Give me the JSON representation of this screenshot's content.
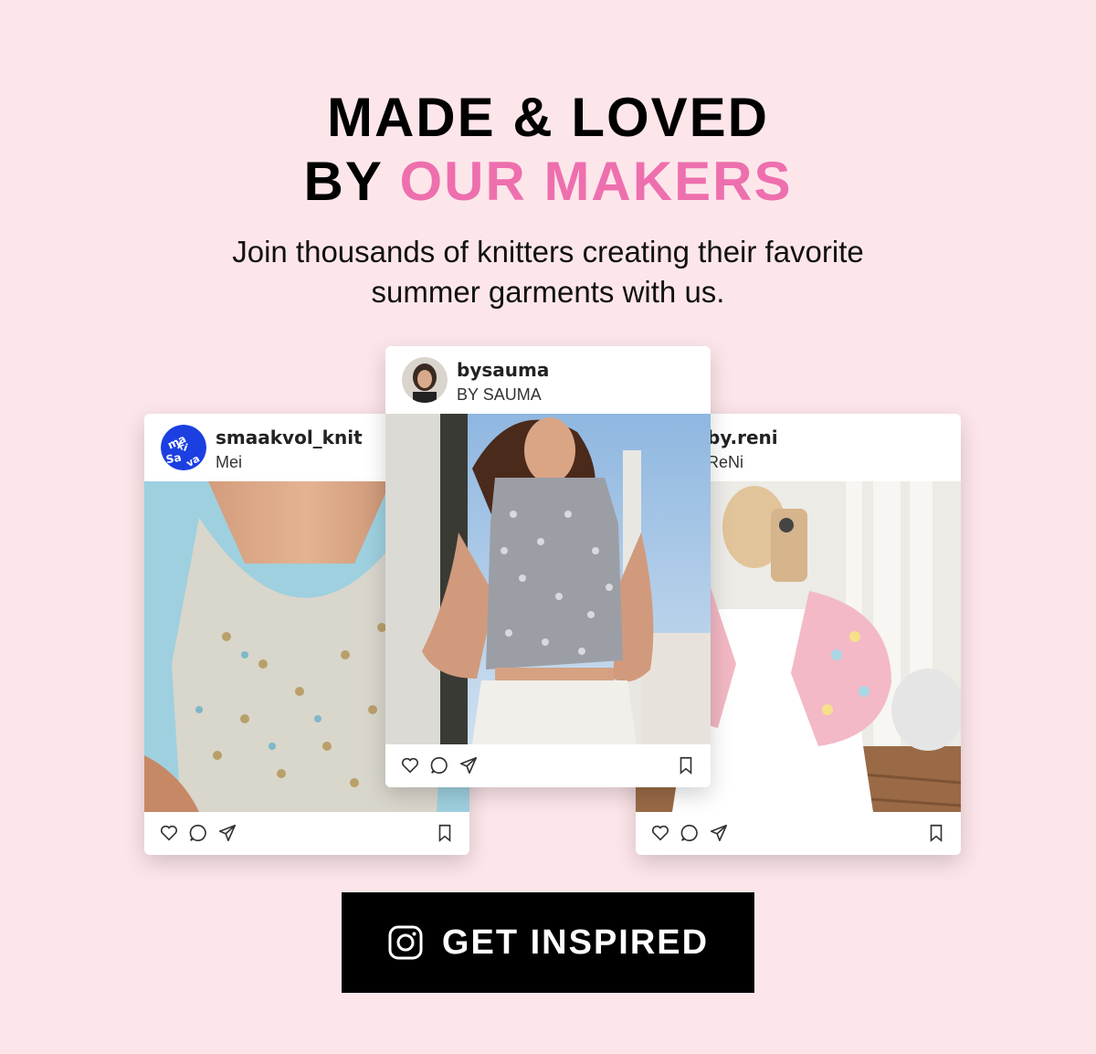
{
  "headline": {
    "line1": "MADE & LOVED",
    "line2_prefix": "BY",
    "line2_accent": "OUR MAKERS"
  },
  "subtitle": {
    "line1": "Join thousands of knitters creating their favorite",
    "line2": "summer garments with us."
  },
  "colors": {
    "background": "#fde6ea",
    "accent": "#ee6fae",
    "cta_bg": "#000000"
  },
  "posts": [
    {
      "handle": "smaakvol_knit",
      "display_name": "Mei"
    },
    {
      "handle": "bysauma",
      "display_name": "BY SAUMA"
    },
    {
      "handle": "by.reni",
      "display_name": "ReNi"
    }
  ],
  "icons": [
    "heart-icon",
    "comment-icon",
    "share-icon",
    "bookmark-icon",
    "instagram-icon"
  ],
  "cta": {
    "label": "GET INSPIRED"
  }
}
